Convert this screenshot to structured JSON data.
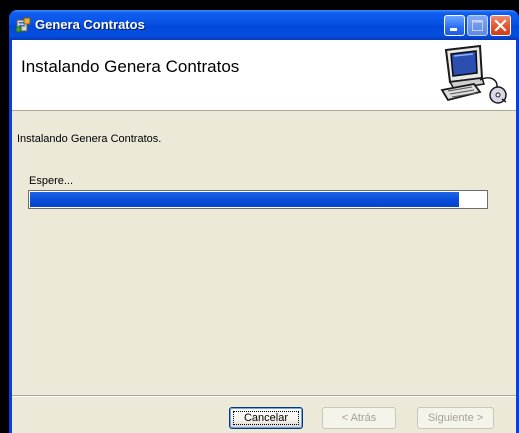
{
  "window": {
    "title": "Genera Contratos",
    "controls": {
      "minimize_icon": "minimize-icon",
      "maximize_icon": "maximize-icon",
      "close_icon": "close-icon"
    }
  },
  "header": {
    "title": "Instalando Genera Contratos",
    "graphic": "computer-install-graphic-icon"
  },
  "body": {
    "status_text": "Instalando Genera Contratos.",
    "progress_label": "Espere...",
    "progress_fraction": 0.94
  },
  "buttons": {
    "cancel": "Cancelar",
    "back": "< Atrás",
    "next": "Siguiente >"
  },
  "colors": {
    "titlebar": "#0852e3",
    "progress": "#0a4ed9",
    "dialog_bg": "#ece9d8"
  }
}
